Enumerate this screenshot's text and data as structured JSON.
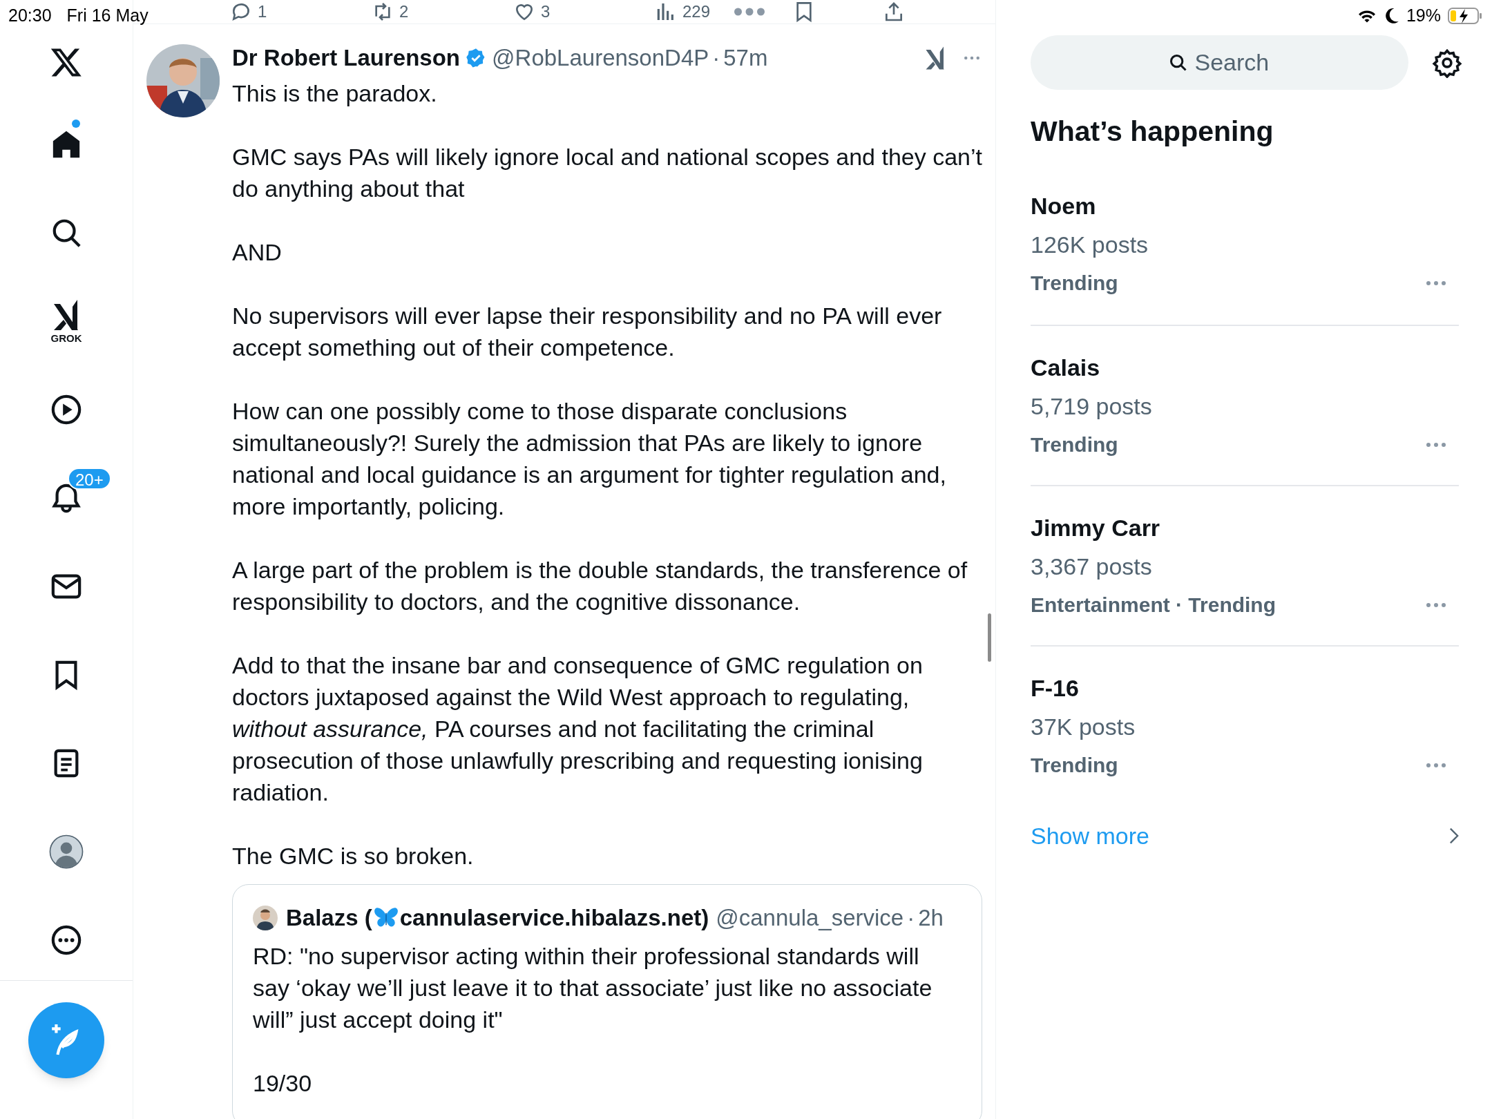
{
  "status_bar": {
    "time": "20:30",
    "date": "Fri 16 May",
    "battery": "19%"
  },
  "nav": [
    {
      "kind": "logo"
    },
    {
      "kind": "home",
      "dot": true
    },
    {
      "kind": "search"
    },
    {
      "kind": "grok",
      "label": "GROK"
    },
    {
      "kind": "video"
    },
    {
      "kind": "notifications",
      "badge": "20+"
    },
    {
      "kind": "messages"
    },
    {
      "kind": "bookmarks"
    },
    {
      "kind": "lists"
    },
    {
      "kind": "profile"
    },
    {
      "kind": "more"
    }
  ],
  "tweet_actions": [
    {
      "kind": "reply",
      "count": "1"
    },
    {
      "kind": "retweet",
      "count": "2"
    },
    {
      "kind": "like",
      "count": "3"
    },
    {
      "kind": "views",
      "count": "229"
    },
    {
      "kind": "more"
    },
    {
      "kind": "bookmark"
    },
    {
      "kind": "share"
    }
  ],
  "tweet": {
    "author": "Dr Robert Laurenson",
    "verified": true,
    "handle": "@RobLaurensonD4P",
    "separator": "·",
    "time": "57m",
    "paragraphs": [
      "This is the paradox.",
      "GMC says PAs will likely ignore local and national scopes and they can’t do anything about that",
      "AND",
      "No supervisors will ever lapse their responsibility and no PA will ever accept something out of their competence.",
      "How can one possibly come to those disparate conclusions simultaneously?! Surely the admission that PAs are likely to ignore national and local guidance is an argument for tighter regulation and, more importantly, policing.",
      "A large part of the problem is the double standards, the transference of responsibility to doctors, and the cognitive dissonance.",
      "Add to that the insane bar and consequence of GMC regulation on doctors juxtaposed against the Wild West approach to regulating, *without assurance,* PA courses and not facilitating the criminal prosecution of those unlawfully prescribing and requesting ionising radiation.",
      "The GMC is so broken."
    ],
    "quote": {
      "name_parts": [
        "Balazs (",
        "cannulaservice.hibalazs.net)"
      ],
      "handle": "@cannula_service",
      "separator": "·",
      "time": "2h",
      "paragraphs": [
        "RD: \"no supervisor acting within their professional standards will say ‘okay we’ll just leave it to that associate’ just like no associate will” just accept doing it\"",
        "19/30"
      ]
    }
  },
  "search": {
    "placeholder": "Search"
  },
  "trends_title": "What’s happening",
  "trends": [
    {
      "name": "Noem",
      "posts": "126K posts",
      "context": "Trending"
    },
    {
      "name": "Calais",
      "posts": "5,719 posts",
      "context": "Trending"
    },
    {
      "name": "Jimmy Carr",
      "posts": "3,367 posts",
      "context": "Entertainment · Trending"
    },
    {
      "name": "F-16",
      "posts": "37K posts",
      "context": "Trending"
    }
  ],
  "show_more": "Show more"
}
